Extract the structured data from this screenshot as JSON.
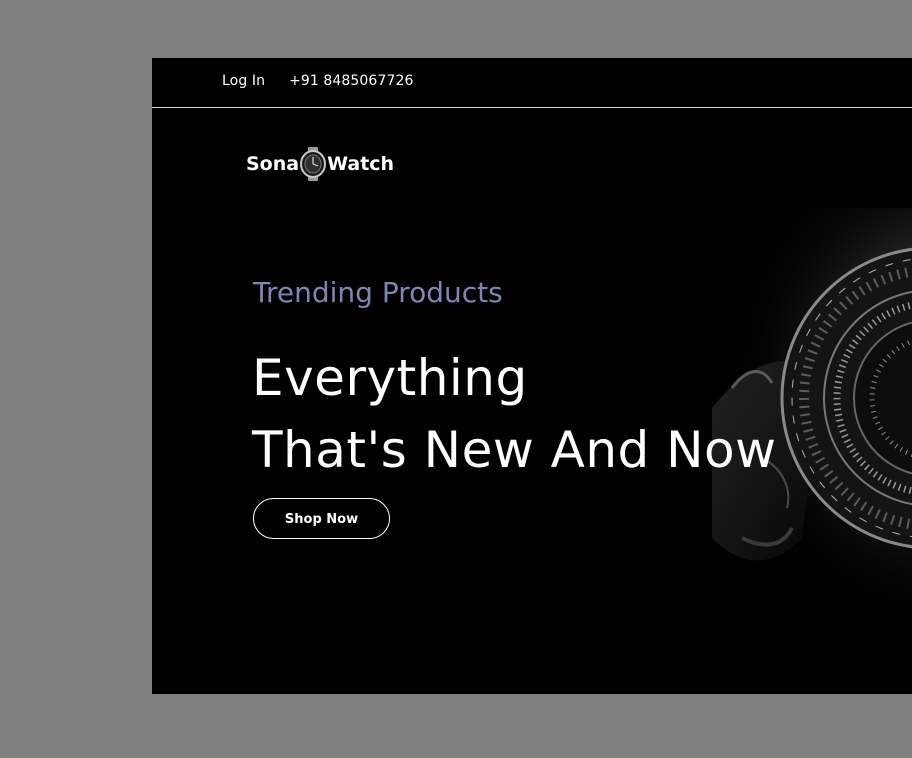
{
  "topbar": {
    "login_label": "Log In",
    "phone": "+91 8485067726"
  },
  "logo": {
    "text_before": "Sona",
    "text_after": "Watch",
    "icon": "watch-icon"
  },
  "hero": {
    "eyebrow": "Trending Products",
    "headline_line1": "Everything",
    "headline_line2": "That's New And Now",
    "cta_label": "Shop Now",
    "image": "watch-dial-image"
  },
  "colors": {
    "backdrop": "#808080",
    "page_background": "#000000",
    "text": "#ffffff",
    "eyebrow": "#7d86b4",
    "divider": "#d9d9d9"
  }
}
